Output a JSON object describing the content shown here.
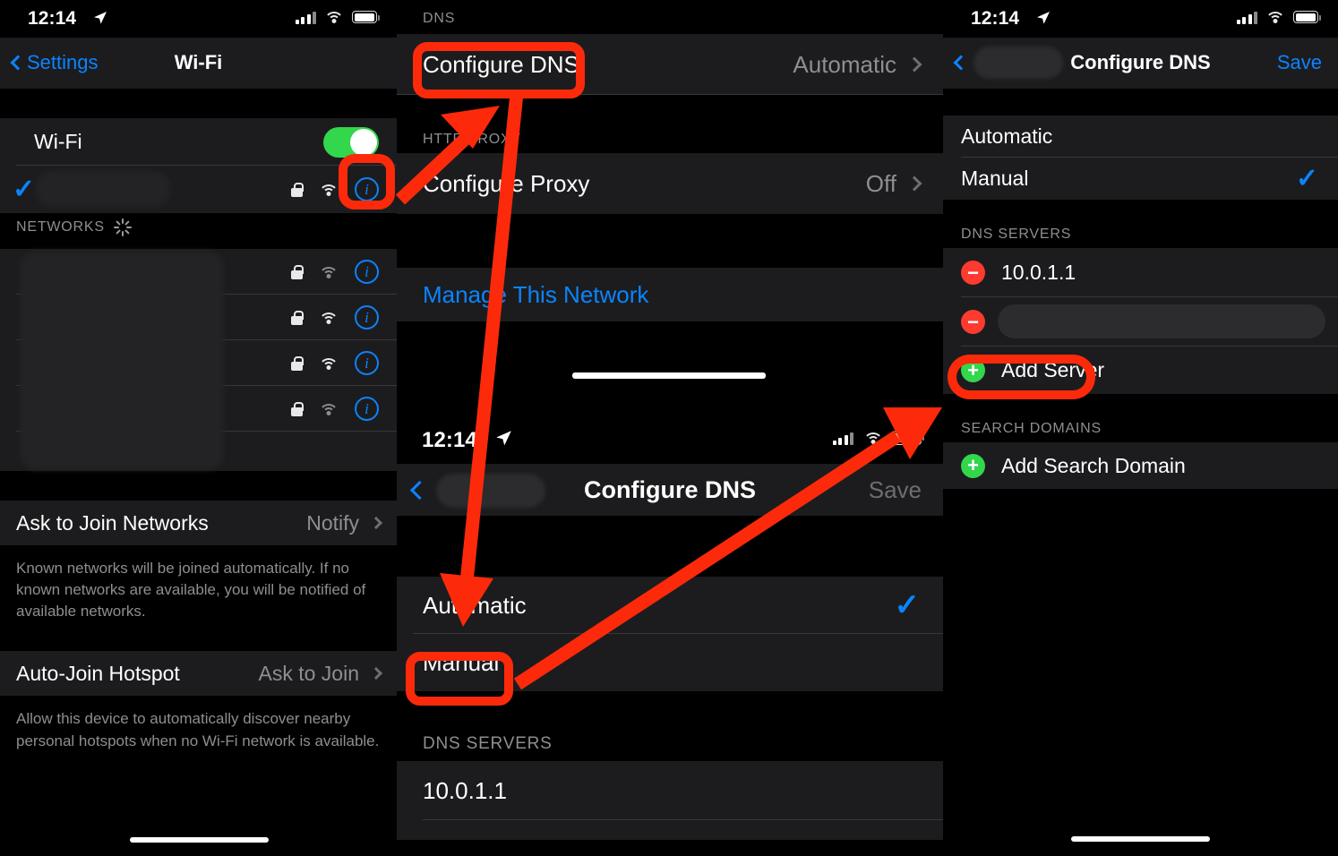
{
  "meta": {
    "accent_blue": "#0a84ff",
    "annotation_red": "#fc2a0a",
    "green": "#32d74b",
    "red": "#ff3b30",
    "row_bg": "#1c1c1e",
    "page_bg": "#000000",
    "secondary_text": "#8e8e93"
  },
  "status_bar": {
    "time": "12:14",
    "location_icon": "location-arrow-icon",
    "cellular_icon": "cellular-bars-icon",
    "wifi_icon": "wifi-icon",
    "battery_icon": "battery-icon"
  },
  "panel_left": {
    "nav": {
      "back_label": "Settings",
      "title": "Wi-Fi"
    },
    "wifi_toggle": {
      "label": "Wi-Fi",
      "state": "on"
    },
    "connected_network": {
      "name": "",
      "checked": true,
      "secured": true,
      "signal": "wifi-3-bars"
    },
    "networks_header": "NETWORKS",
    "networks": [
      {
        "name": "",
        "secured": true,
        "signal": "wifi-2-bars"
      },
      {
        "name": "",
        "secured": true,
        "signal": "wifi-3-bars"
      },
      {
        "name": "",
        "secured": true,
        "signal": "wifi-3-bars"
      },
      {
        "name": "",
        "secured": true,
        "signal": "wifi-2-bars"
      }
    ],
    "ask_to_join": {
      "label": "Ask to Join Networks",
      "value": "Notify"
    },
    "ask_to_join_note": "Known networks will be joined automatically. If no known networks are available, you will be notified of available networks.",
    "auto_join_hotspot": {
      "label": "Auto-Join Hotspot",
      "value": "Ask to Join"
    },
    "auto_join_note": "Allow this device to automatically discover nearby personal hotspots when no Wi-Fi network is available."
  },
  "panel_mid": {
    "dns_header": "DNS",
    "configure_dns": {
      "label": "Configure DNS",
      "value": "Automatic"
    },
    "proxy_header": "HTTP PROXY",
    "configure_proxy": {
      "label": "Configure Proxy",
      "value": "Off"
    },
    "manage_network": "Manage This Network",
    "sheet": {
      "status_bar": {
        "time": "12:14"
      },
      "nav": {
        "title": "Configure DNS",
        "save_label": "Save"
      },
      "options": [
        {
          "label": "Automatic",
          "checked": true
        },
        {
          "label": "Manual",
          "checked": false
        }
      ],
      "dns_servers_header": "DNS SERVERS",
      "dns_servers": [
        {
          "value": "10.0.1.1"
        }
      ]
    }
  },
  "panel_right": {
    "status_bar": {
      "time": "12:14"
    },
    "nav": {
      "back_label": "",
      "title": "Configure DNS",
      "save_label": "Save"
    },
    "options": [
      {
        "label": "Automatic",
        "checked": false
      },
      {
        "label": "Manual",
        "checked": true
      }
    ],
    "dns_servers_header": "DNS SERVERS",
    "dns_servers": [
      {
        "value": "10.0.1.1",
        "remove_icon": "minus-circle-icon"
      },
      {
        "value": "",
        "remove_icon": "minus-circle-icon"
      }
    ],
    "add_server": {
      "label": "Add Server",
      "icon": "plus-circle-icon"
    },
    "search_domains_header": "SEARCH DOMAINS",
    "add_search_domain": {
      "label": "Add Search Domain",
      "icon": "plus-circle-icon"
    }
  },
  "annotations": {
    "highlights": [
      {
        "name": "info-button-highlight"
      },
      {
        "name": "configure-dns-highlight"
      },
      {
        "name": "manual-option-highlight"
      },
      {
        "name": "add-server-highlight"
      }
    ],
    "arrows": [
      {
        "name": "arrow-info-to-configure-dns"
      },
      {
        "name": "arrow-configure-dns-to-manual"
      },
      {
        "name": "arrow-manual-to-add-server"
      }
    ]
  }
}
